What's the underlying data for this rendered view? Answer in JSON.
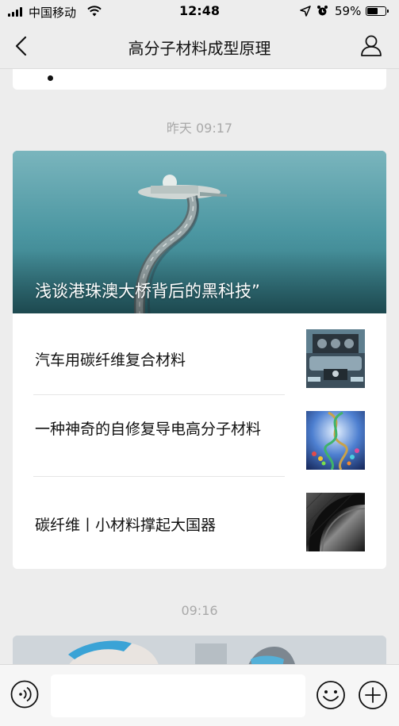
{
  "status_bar": {
    "carrier": "中国移动",
    "time": "12:48",
    "battery": "59%"
  },
  "nav": {
    "title": "高分子材料成型原理"
  },
  "feed": {
    "timestamp_1": "昨天 09:17",
    "cover_article": {
      "title": "浅谈港珠澳大桥背后的黑科技”"
    },
    "articles": [
      {
        "title": "汽车用碳纤维复合材料",
        "thumb_icon": "car-engine-image"
      },
      {
        "title": "一种神奇的自修复导电高分子材料",
        "thumb_icon": "molecule-image"
      },
      {
        "title": "碳纤维丨小材料撑起大国器",
        "thumb_icon": "carbon-fiber-image"
      }
    ],
    "timestamp_2": "09:16"
  },
  "input_bar": {
    "placeholder": ""
  }
}
